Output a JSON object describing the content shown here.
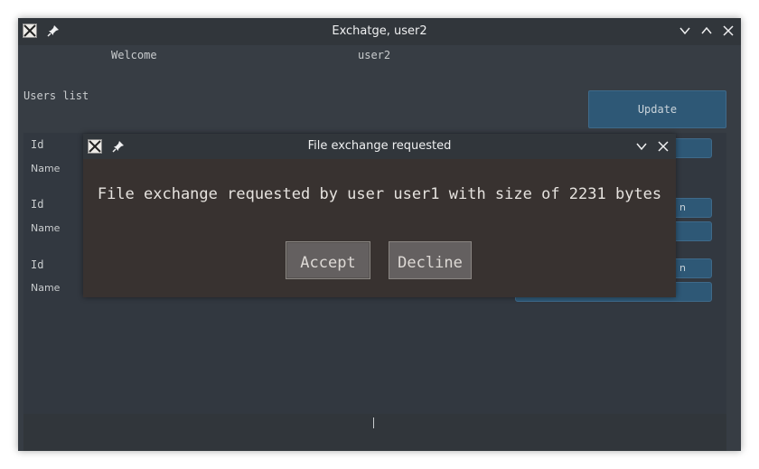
{
  "window": {
    "title": "Exchatge, user2",
    "icons": {
      "app": "x-app-icon",
      "pin": "pin-icon",
      "minimize": "chevron-down-icon",
      "maximize": "chevron-up-icon",
      "close": "close-icon"
    }
  },
  "header": {
    "welcome_label": "Welcome",
    "username": "user2"
  },
  "users": {
    "label": "Users list",
    "update_label": "Update",
    "rows": [
      {
        "id_label": "Id",
        "name_label": "Name",
        "button_text": ""
      },
      {
        "id_label": "Id",
        "name_label": "Name",
        "button_text": "n"
      },
      {
        "id_label": "Id",
        "name_label": "Name",
        "button_text": "n"
      }
    ]
  },
  "statusbar": {
    "text": "|"
  },
  "dialog": {
    "title": "File exchange requested",
    "message": "File exchange requested by user user1 with size of 2231 bytes",
    "accept_label": "Accept",
    "decline_label": "Decline"
  },
  "colors": {
    "window_bg": "#373d44",
    "titlebar_bg": "#31363b",
    "accent_button": "#2e5876",
    "dialog_bg": "#383230",
    "dialog_button": "#646060"
  }
}
